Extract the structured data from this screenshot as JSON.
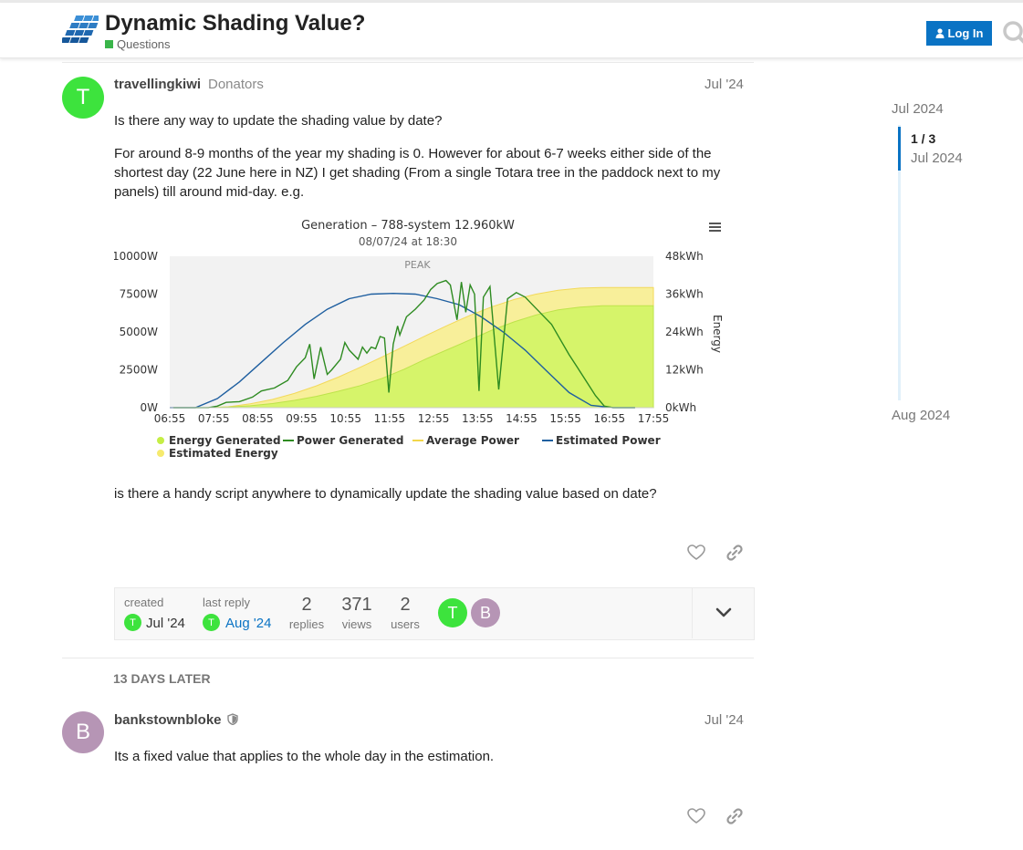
{
  "header": {
    "title": "Dynamic Shading Value?",
    "category": "Questions",
    "login_label": "Log In"
  },
  "colors": {
    "accent": "#0a73c4",
    "category": "#3ab54a",
    "avatar_t": "#3de33d",
    "avatar_b": "#b695b5"
  },
  "post1": {
    "avatar_letter": "T",
    "username": "travellingkiwi",
    "group": "Donators",
    "date": "Jul '24",
    "para1": "Is there any way to update the shading value by date?",
    "para2": "For around 8-9 months of the year my shading is 0. However for about 6-7 weeks either side of the shortest day (22 June here in NZ) I get shading (From a single Totara tree in the paddock next to my panels) till around mid-day. e.g.",
    "para3": "is there a handy script anywhere to dynamically update the shading value based on date?"
  },
  "chart_data": {
    "type": "area",
    "title": "Generation – 788-system 12.960kW",
    "subtitle": "08/07/24 at 18:30",
    "plot_band_label": "PEAK",
    "y_left": {
      "ticks": [
        "0W",
        "2500W",
        "5000W",
        "7500W",
        "10000W"
      ],
      "range": [
        0,
        10000
      ]
    },
    "y_right": {
      "label": "Energy",
      "ticks": [
        "0kWh",
        "12kWh",
        "24kWh",
        "36kWh",
        "48kWh"
      ],
      "range": [
        0,
        48
      ]
    },
    "x_ticks": [
      "06:55",
      "07:55",
      "08:55",
      "09:55",
      "10:55",
      "11:55",
      "12:55",
      "13:55",
      "14:55",
      "15:55",
      "16:55",
      "17:55"
    ],
    "x_range_hours": [
      6.917,
      17.917
    ],
    "legend": [
      {
        "name": "Energy Generated",
        "marker": "dot",
        "color": "#c5ee45"
      },
      {
        "name": "Power Generated",
        "marker": "line",
        "color": "#2e8b21"
      },
      {
        "name": "Average Power",
        "marker": "line",
        "color": "#f2d64a"
      },
      {
        "name": "Estimated Power",
        "marker": "line",
        "color": "#1f5fa0"
      },
      {
        "name": "Estimated Energy",
        "marker": "dot",
        "color": "#f6ea6e"
      }
    ],
    "series": [
      {
        "name": "Estimated Energy",
        "axis": "right",
        "x": [
          7.75,
          8.25,
          8.75,
          9.25,
          9.75,
          10.25,
          10.75,
          11.25,
          11.75,
          12.25,
          12.75,
          13.25,
          13.75,
          14.25,
          14.75,
          15.25,
          15.75,
          16.25,
          16.75,
          17.25,
          17.917
        ],
        "values": [
          0,
          0.3,
          1.2,
          2.6,
          4.5,
          6.9,
          9.7,
          12.8,
          16.1,
          19.5,
          22.9,
          26.2,
          29.3,
          32.0,
          34.3,
          36.0,
          37.2,
          37.9,
          38.1,
          38.1,
          38.1
        ]
      },
      {
        "name": "Energy Generated",
        "axis": "right",
        "x": [
          7.75,
          8.25,
          8.75,
          9.25,
          9.75,
          10.25,
          10.75,
          11.25,
          11.75,
          12.25,
          12.75,
          13.25,
          13.75,
          14.25,
          14.75,
          15.25,
          15.75,
          16.25,
          16.75,
          17.25,
          17.917
        ],
        "values": [
          0,
          0.2,
          0.6,
          1.3,
          2.3,
          3.6,
          5.2,
          7.0,
          9.3,
          12.2,
          15.5,
          18.5,
          21.5,
          24.6,
          27.2,
          29.4,
          31.0,
          31.9,
          32.3,
          32.3,
          32.3
        ]
      },
      {
        "name": "Estimated Power",
        "axis": "left",
        "x": [
          6.917,
          7.5,
          8.0,
          8.5,
          9.0,
          9.5,
          10.0,
          10.5,
          11.0,
          11.5,
          12.0,
          12.5,
          13.0,
          13.5,
          14.0,
          14.5,
          15.0,
          15.5,
          16.0,
          16.5,
          17.0,
          17.5
        ],
        "values": [
          0,
          0,
          600,
          1700,
          3000,
          4300,
          5500,
          6500,
          7200,
          7500,
          7550,
          7500,
          7200,
          6800,
          6000,
          5000,
          3800,
          2400,
          1000,
          150,
          0,
          0
        ]
      },
      {
        "name": "Power Generated",
        "axis": "left",
        "x": [
          7.0,
          7.8,
          8.0,
          8.2,
          8.5,
          8.8,
          9.0,
          9.3,
          9.6,
          9.8,
          10.0,
          10.1,
          10.2,
          10.35,
          10.5,
          10.6,
          10.8,
          10.9,
          11.0,
          11.2,
          11.3,
          11.4,
          11.5,
          11.6,
          11.7,
          11.8,
          11.9,
          12.0,
          12.1,
          12.15,
          12.3,
          12.5,
          12.7,
          12.85,
          13.0,
          13.2,
          13.3,
          13.45,
          13.55,
          13.65,
          13.75,
          13.85,
          13.95,
          14.05,
          14.2,
          14.4,
          14.6,
          14.8,
          15.0,
          15.2,
          15.4,
          15.6,
          15.8,
          16.0,
          16.2,
          16.4,
          16.6,
          16.8,
          17.0,
          17.5
        ],
        "values": [
          0,
          0,
          100,
          350,
          400,
          700,
          1100,
          1300,
          1800,
          2700,
          3300,
          4200,
          1900,
          4000,
          2200,
          2500,
          3200,
          4300,
          3800,
          3200,
          4000,
          3600,
          4000,
          3900,
          4700,
          4600,
          1000,
          4200,
          5400,
          4800,
          6000,
          6500,
          7100,
          7800,
          8200,
          8400,
          8100,
          5800,
          8300,
          6300,
          8100,
          7500,
          1100,
          7300,
          8000,
          1200,
          7200,
          7600,
          7300,
          6700,
          6100,
          5500,
          4500,
          3500,
          2600,
          1700,
          800,
          100,
          0,
          0
        ]
      }
    ]
  },
  "post_actions": {
    "like_icon": "heart-icon",
    "share_icon": "link-icon"
  },
  "topic_map": {
    "created_label": "created",
    "created_date": "Jul '24",
    "created_avatar": "T",
    "last_reply_label": "last reply",
    "last_reply_date": "Aug '24",
    "last_reply_avatar": "T",
    "replies_num": "2",
    "replies_label": "replies",
    "views_num": "371",
    "views_label": "views",
    "users_num": "2",
    "users_label": "users",
    "avatar1": "T",
    "avatar2": "B"
  },
  "small_action": "13 DAYS LATER",
  "post2": {
    "avatar_letter": "B",
    "username": "bankstownbloke",
    "date": "Jul '24",
    "para1": "Its a fixed value that applies to the whole day in the estimation."
  },
  "timeline": {
    "start_date": "Jul 2024",
    "position": "1 / 3",
    "position_date": "Jul 2024",
    "end_date": "Aug 2024"
  }
}
